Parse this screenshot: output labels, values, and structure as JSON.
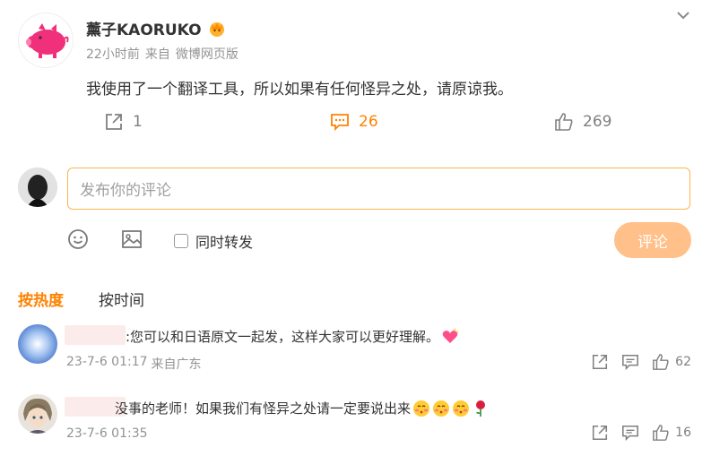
{
  "post": {
    "author": "薰子KAORUKO",
    "time": "22小时前",
    "source_prefix": "来自",
    "source": "微博网页版",
    "text": "我使用了一个翻译工具，所以如果有任何怪异之处，请原谅我。",
    "forward_count": "1",
    "comment_count": "26",
    "like_count": "269"
  },
  "composer": {
    "placeholder": "发布你的评论",
    "repost_label": "同时转发",
    "submit_label": "评论"
  },
  "sort": {
    "hot": "按热度",
    "time": "按时间"
  },
  "comments": [
    {
      "text": ":您可以和日语原文一起发，这样大家可以更好理解。",
      "date": "23-7-6 01:17",
      "source": "来自广东",
      "likes": "62"
    },
    {
      "text": "没事的老师！如果我们有怪异之处请一定要说出来",
      "date": "23-7-6 01:35",
      "source": "",
      "likes": "16"
    }
  ],
  "colors": {
    "accent": "#ff8200",
    "submit_disabled": "#ffc08a",
    "input_border": "#ffb54f"
  }
}
